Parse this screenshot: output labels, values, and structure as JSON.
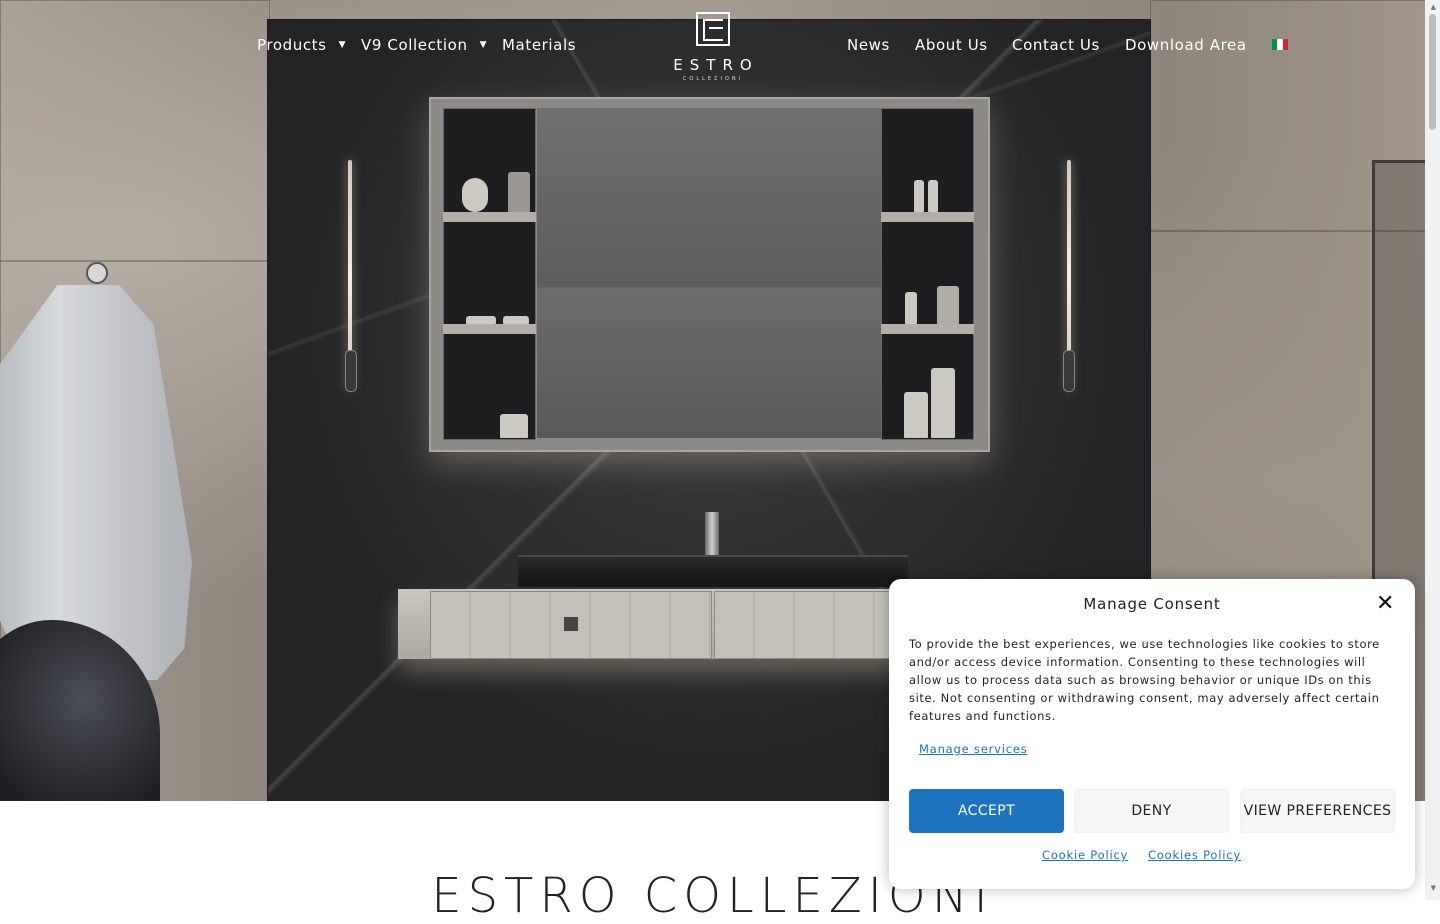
{
  "nav": {
    "left": [
      {
        "label": "Products",
        "dropdown": true
      },
      {
        "label": "V9 Collection",
        "dropdown": true
      },
      {
        "label": "Materials",
        "dropdown": false
      }
    ],
    "right": [
      {
        "label": "News"
      },
      {
        "label": "About Us"
      },
      {
        "label": "Contact Us"
      },
      {
        "label": "Download Area"
      }
    ],
    "language_flag": "it-flag-icon",
    "flag_colors": [
      "#009246",
      "#ffffff",
      "#ce2b37"
    ]
  },
  "logo": {
    "wordmark": "ESTRO",
    "subtitle": "COLLEZIONI"
  },
  "hero": {
    "image": "bathroom-vanity-scene"
  },
  "page": {
    "heading": "ESTRO COLLEZIONI"
  },
  "consent": {
    "title": "Manage Consent",
    "text": "To provide the best experiences, we use technologies like cookies to store and/or access device information. Consenting to these technologies will allow us to process data such as browsing behavior or unique IDs on this site. Not consenting or withdrawing consent, may adversely affect certain features and functions.",
    "manage_services": "Manage services",
    "accept_label": "ACCEPT",
    "deny_label": "DENY",
    "preferences_label": "VIEW PREFERENCES",
    "cookie_policy": "Cookie Policy",
    "cookies_policy": "Cookies Policy",
    "accent_color": "#1e73be"
  }
}
